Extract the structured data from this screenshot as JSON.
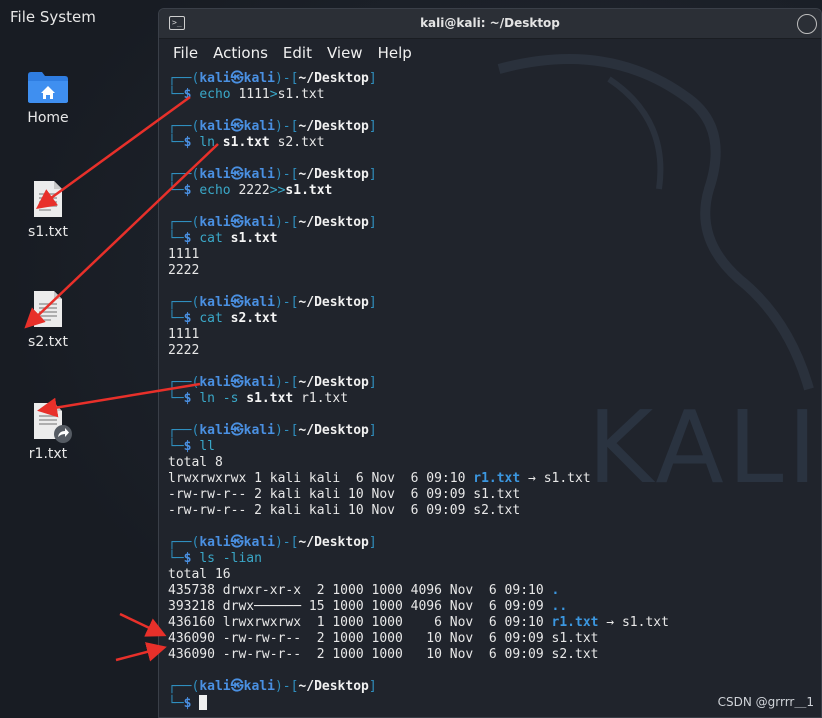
{
  "desktop": {
    "file_system_label": "File System",
    "icons": [
      {
        "label": "Home",
        "icon": "home-folder-icon"
      },
      {
        "label": "s1.txt",
        "icon": "text-file-icon"
      },
      {
        "label": "s2.txt",
        "icon": "text-file-icon"
      },
      {
        "label": "r1.txt",
        "icon": "symlink-file-icon"
      }
    ]
  },
  "window": {
    "title": "kali@kali: ~/Desktop",
    "menu": [
      "File",
      "Actions",
      "Edit",
      "View",
      "Help"
    ]
  },
  "prompt": {
    "user": "kali",
    "at": "㉿",
    "host": "kali",
    "path": "~/Desktop"
  },
  "blocks": [
    {
      "cmd": "echo",
      "args": [
        {
          "t": " 1111",
          "s": "arg"
        },
        {
          "t": ">",
          "s": "cmd"
        },
        {
          "t": "s1.txt",
          "s": "arg"
        }
      ],
      "out": []
    },
    {
      "cmd": "ln",
      "args": [
        {
          "t": " ",
          "s": "arg"
        },
        {
          "t": "s1.txt",
          "s": "bold"
        },
        {
          "t": " s2.txt",
          "s": "arg"
        }
      ],
      "out": []
    },
    {
      "cmd": "echo",
      "args": [
        {
          "t": " 2222",
          "s": "arg"
        },
        {
          "t": ">>",
          "s": "cmd"
        },
        {
          "t": "s1.txt",
          "s": "bold"
        }
      ],
      "out": []
    },
    {
      "cmd": "cat",
      "args": [
        {
          "t": " ",
          "s": "arg"
        },
        {
          "t": "s1.txt",
          "s": "bold"
        }
      ],
      "out": [
        "1111",
        "2222"
      ]
    },
    {
      "cmd": "cat",
      "args": [
        {
          "t": " ",
          "s": "arg"
        },
        {
          "t": "s2.txt",
          "s": "bold"
        }
      ],
      "out": [
        "1111",
        "2222"
      ]
    },
    {
      "cmd": "ln",
      "args": [
        {
          "t": " -s ",
          "s": "cmd"
        },
        {
          "t": "s1.txt",
          "s": "bold"
        },
        {
          "t": " r1.txt",
          "s": "arg"
        }
      ],
      "out": []
    },
    {
      "cmd": "ll",
      "args": [],
      "out": [
        "total 8",
        [
          {
            "t": "lrwxrwxrwx 1 kali kali  6 Nov  6 09:10 ",
            "s": "out"
          },
          {
            "t": "r1.txt",
            "s": "link"
          },
          {
            "t": " → s1.txt",
            "s": "out"
          }
        ],
        "-rw-rw-r-- 2 kali kali 10 Nov  6 09:09 s1.txt",
        "-rw-rw-r-- 2 kali kali 10 Nov  6 09:09 s2.txt"
      ]
    },
    {
      "cmd": "ls",
      "args": [
        {
          "t": " -lian",
          "s": "cmd"
        }
      ],
      "out": [
        "total 16",
        [
          {
            "t": "435738 drwxr-xr-x  2 1000 1000 4096 Nov  6 09:10 ",
            "s": "out"
          },
          {
            "t": ".",
            "s": "link"
          }
        ],
        [
          {
            "t": "393218 drwx────── 15 1000 1000 4096 Nov  6 09:09 ",
            "s": "out"
          },
          {
            "t": "..",
            "s": "link"
          }
        ],
        [
          {
            "t": "436160 lrwxrwxrwx  1 1000 1000    6 Nov  6 09:10 ",
            "s": "out"
          },
          {
            "t": "r1.txt",
            "s": "link"
          },
          {
            "t": " → s1.txt",
            "s": "out"
          }
        ],
        "436090 -rw-rw-r--  2 1000 1000   10 Nov  6 09:09 s1.txt",
        "436090 -rw-rw-r--  2 1000 1000   10 Nov  6 09:09 s2.txt"
      ]
    }
  ],
  "watermark_text": "KALI",
  "footer": "CSDN @grrrr＿1",
  "colors": {
    "arrow": "#e8302a",
    "prompt_blue": "#4a90e2",
    "bracket": "#2f8fbf"
  }
}
